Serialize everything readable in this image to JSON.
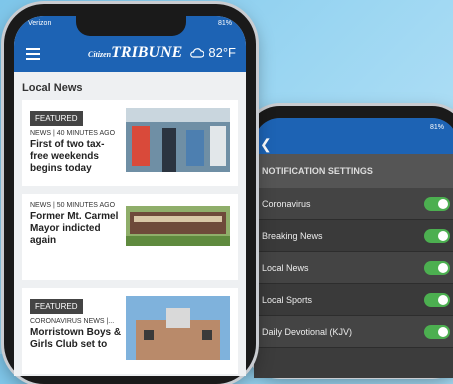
{
  "phone1": {
    "carrier": "Verizon",
    "battery": "81%",
    "logo_small": "Citizen",
    "logo_main": "TRIBUNE",
    "temperature": "82°F",
    "section_title": "Local News",
    "articles": [
      {
        "badge": "FEATURED",
        "meta": "NEWS | 40 MINUTES AGO",
        "title": "First of two tax-free weekends begins today"
      },
      {
        "badge": "",
        "meta": "NEWS | 50 MINUTES AGO",
        "title": "Former Mt. Carmel Mayor indicted again"
      },
      {
        "badge": "FEATURED",
        "meta": "CORONAVIRUS NEWS |...",
        "title": "Morristown Boys & Girls Club set to"
      }
    ]
  },
  "phone2": {
    "battery": "81%",
    "section_title": "NOTIFICATION SETTINGS",
    "settings": [
      {
        "label": "Coronavirus",
        "on": true
      },
      {
        "label": "Breaking News",
        "on": true
      },
      {
        "label": "Local News",
        "on": true
      },
      {
        "label": "Local Sports",
        "on": true
      },
      {
        "label": "Daily Devotional (KJV)",
        "on": true
      }
    ]
  }
}
